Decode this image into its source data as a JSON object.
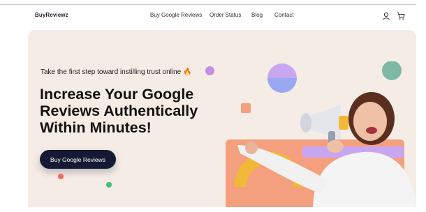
{
  "header": {
    "brand": "BuyReviewz",
    "nav": [
      {
        "label": "Buy Google Reviews"
      },
      {
        "label": "Order Status"
      },
      {
        "label": "Blog"
      },
      {
        "label": "Contact"
      }
    ],
    "icons": [
      "user-icon",
      "cart-icon"
    ]
  },
  "hero": {
    "tagline": "Take the first step toward instilling trust online",
    "tagline_emoji": "🔥",
    "headline_lines": [
      "Increase Your Google",
      "Reviews Authentically",
      "Within Minutes!"
    ],
    "cta_label": "Buy Google Reviews",
    "illustration": "woman-with-megaphone-photo"
  },
  "colors": {
    "hero_bg": "#f6ece6",
    "cta_bg": "#141a33",
    "salmon": "#f4a07f",
    "mustard": "#f2b938",
    "lavender": "#c9a6f0",
    "teal": "#7fb9a5",
    "periwinkle": "#9aa8f3"
  }
}
